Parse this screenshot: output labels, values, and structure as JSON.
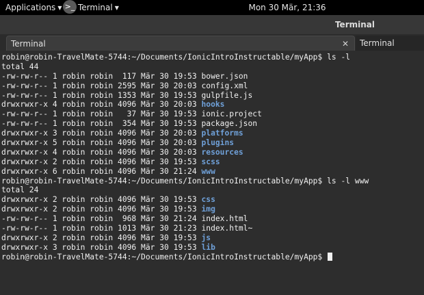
{
  "topbar": {
    "applications_label": "Applications",
    "terminal_app_label": "Terminal",
    "clock": "Mon 30 Mär, 21:36"
  },
  "window": {
    "title": "Terminal"
  },
  "tabs": [
    {
      "label": "Terminal",
      "active": true
    },
    {
      "label": "Terminal",
      "active": false
    }
  ],
  "terminal": {
    "lines": [
      {
        "text": "robin@robin-TravelMate-5744:~/Documents/IonicIntroInstructable/myApp$ ls -l"
      },
      {
        "text": "total 44"
      },
      {
        "text": "-rw-rw-r-- 1 robin robin  117 Mär 30 19:53 ",
        "name": "bower.json",
        "dir": false
      },
      {
        "text": "-rw-rw-r-- 1 robin robin 2595 Mär 30 20:03 ",
        "name": "config.xml",
        "dir": false
      },
      {
        "text": "-rw-rw-r-- 1 robin robin 1353 Mär 30 19:53 ",
        "name": "gulpfile.js",
        "dir": false
      },
      {
        "text": "drwxrwxr-x 4 robin robin 4096 Mär 30 20:03 ",
        "name": "hooks",
        "dir": true
      },
      {
        "text": "-rw-rw-r-- 1 robin robin   37 Mär 30 19:53 ",
        "name": "ionic.project",
        "dir": false
      },
      {
        "text": "-rw-rw-r-- 1 robin robin  354 Mär 30 19:53 ",
        "name": "package.json",
        "dir": false
      },
      {
        "text": "drwxrwxr-x 3 robin robin 4096 Mär 30 20:03 ",
        "name": "platforms",
        "dir": true
      },
      {
        "text": "drwxrwxr-x 5 robin robin 4096 Mär 30 20:03 ",
        "name": "plugins",
        "dir": true
      },
      {
        "text": "drwxrwxr-x 4 robin robin 4096 Mär 30 20:03 ",
        "name": "resources",
        "dir": true
      },
      {
        "text": "drwxrwxr-x 2 robin robin 4096 Mär 30 19:53 ",
        "name": "scss",
        "dir": true
      },
      {
        "text": "drwxrwxr-x 6 robin robin 4096 Mär 30 21:24 ",
        "name": "www",
        "dir": true
      },
      {
        "text": "robin@robin-TravelMate-5744:~/Documents/IonicIntroInstructable/myApp$ ls -l www"
      },
      {
        "text": "total 24"
      },
      {
        "text": "drwxrwxr-x 2 robin robin 4096 Mär 30 19:53 ",
        "name": "css",
        "dir": true
      },
      {
        "text": "drwxrwxr-x 2 robin robin 4096 Mär 30 19:53 ",
        "name": "img",
        "dir": true
      },
      {
        "text": "-rw-rw-r-- 1 robin robin  968 Mär 30 21:24 ",
        "name": "index.html",
        "dir": false
      },
      {
        "text": "-rw-rw-r-- 1 robin robin 1013 Mär 30 21:23 ",
        "name": "index.html~",
        "dir": false
      },
      {
        "text": "drwxrwxr-x 2 robin robin 4096 Mär 30 19:53 ",
        "name": "js",
        "dir": true
      },
      {
        "text": "drwxrwxr-x 3 robin robin 4096 Mär 30 19:53 ",
        "name": "lib",
        "dir": true
      },
      {
        "text": "robin@robin-TravelMate-5744:~/Documents/IonicIntroInstructable/myApp$ ",
        "cursor": true
      }
    ]
  },
  "colors": {
    "directory": "#6fa0d8",
    "terminal_bg": "#2d2d2d",
    "topbar_bg": "#000000"
  }
}
